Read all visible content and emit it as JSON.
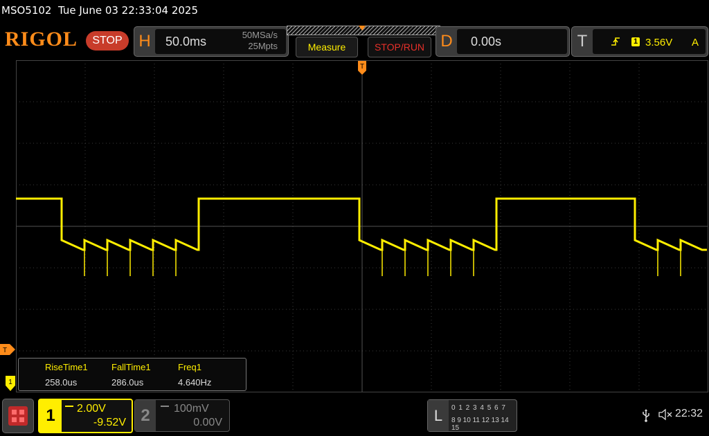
{
  "header": {
    "model": "MSO5102",
    "datetime": "Tue June 03 22:33:04 2025",
    "brand": "RIGOL",
    "run_state": "STOP"
  },
  "horizontal": {
    "letter": "H",
    "timebase": "50.0ms",
    "sample_rate": "50MSa/s",
    "memory_depth": "25Mpts"
  },
  "buttons": {
    "measure": "Measure",
    "stop_run": "STOP/RUN"
  },
  "delay": {
    "letter": "D",
    "value": "0.00s"
  },
  "trigger": {
    "letter": "T",
    "source": "1",
    "level": "3.56V",
    "mode": "A",
    "marker_label": "T"
  },
  "measurements": [
    {
      "name": "RiseTime1",
      "value": "258.0us"
    },
    {
      "name": "FallTime1",
      "value": "286.0us"
    },
    {
      "name": "Freq1",
      "value": "4.640Hz"
    }
  ],
  "channel1": {
    "number": "1",
    "scale": "2.00V",
    "offset": "-9.52V",
    "color": "#ffee00"
  },
  "channel2": {
    "number": "2",
    "scale": "100mV",
    "offset": "0.00V",
    "color": "#888888"
  },
  "logic": {
    "letter": "L",
    "row1": "0 1 2 3  4 5 6 7",
    "row2": "8 9 10 11 12 13 14 15"
  },
  "status": {
    "time": "22:32",
    "icons": [
      "usb-icon",
      "speaker-muted-icon"
    ]
  },
  "colors": {
    "accent_orange": "#ff8c1a",
    "trace_yellow": "#ffee00",
    "stop_red": "#c83c2a"
  }
}
